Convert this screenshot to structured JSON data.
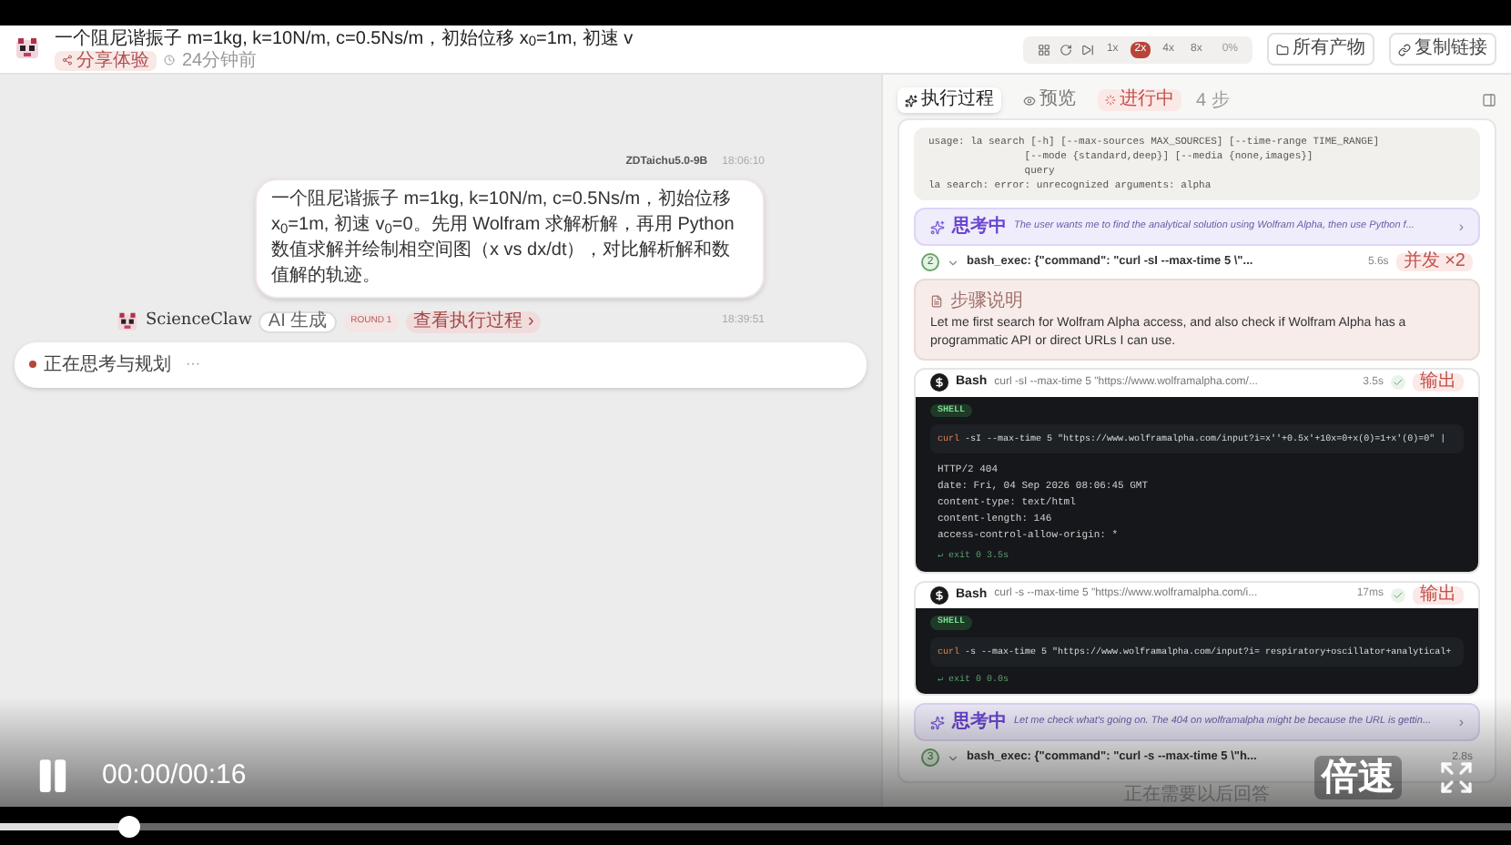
{
  "header": {
    "title": "一个阻尼谐振子 m=1kg, k=10N/m, c=0.5Ns/m，初始位移 x$_{0}$=1m, 初速 v",
    "badge": "分享体验",
    "time": "24分钟前",
    "speeds": [
      {
        "label": "1x",
        "selected": false
      },
      {
        "label": "2x",
        "selected": true
      },
      {
        "label": "4x",
        "selected": false
      },
      {
        "label": "8x",
        "selected": false
      }
    ],
    "zoom": "0%",
    "buttons": [
      {
        "kind": "folder",
        "label": "所有产物"
      },
      {
        "kind": "link",
        "label": "复制链接"
      }
    ]
  },
  "chat": {
    "user": {
      "name": "ZDTaichu5.0-9B",
      "time": "18:06:10",
      "text": "一个阻尼谐振子 m=1kg, k=10N/m, c=0.5Ns/m，初始位移 x$_{0}$=1m, 初速 v$_{0}$=0。先用 Wolfram 求解析解，再用 Python 数值求解并绘制相空间图（x vs dx/dt），对比解析解和数值解的轨迹。"
    },
    "assistant": {
      "name": "ScienceClaw",
      "tag": "AI 生成",
      "round": "ROUND 1",
      "link": "查看执行过程 ›",
      "time": "18:39:51",
      "status": "正在思考与规划",
      "dots": "···"
    }
  },
  "panel": {
    "tabs": [
      {
        "label": "执行过程",
        "selected": true
      },
      {
        "label": "预览",
        "selected": false
      }
    ],
    "state": "进行中",
    "steps": "4 步",
    "items": [
      {
        "kind": "code",
        "lines": [
          "usage: la search [-h] [--max-sources MAX_SOURCES] [--time-range TIME_RANGE]",
          "                [--mode {standard,deep}] [--media {none,images}]",
          "                query",
          "la search: error: unrecognized arguments: alpha"
        ]
      },
      {
        "kind": "thinking",
        "label": "思考中",
        "text": "The user wants me to find the analytical solution using Wolfram Alpha, then use Python f...",
        "arrow": "›"
      },
      {
        "kind": "step",
        "number": "2",
        "expanded": true,
        "text": "bash_exec: {\"command\": \"curl -sI --max-time 5 \\\"...",
        "time": "5.6s",
        "badge": "并发 ×2"
      },
      {
        "kind": "note",
        "title": "步骤说明",
        "text": "Let me first search for Wolfram Alpha access, and also check if Wolfram Alpha has a programmatic API or direct URLs I can use."
      },
      {
        "kind": "bash",
        "name": "Bash",
        "command": "curl -sI --max-time 5 \"https://www.wolframalpha.com/...",
        "time": "3.5s",
        "done": true,
        "output_label": "输出",
        "shell": "SHELL",
        "program": "curl",
        "args": "-sI --max-time 5 \"https://www.wolframalpha.com/input?i=x''+0.5x'+10x=0+x(0)=1+x'(0)=0\" |",
        "output": [
          "HTTP/2 404",
          "date: Fri, 04 Sep 2026 08:06:45 GMT",
          "content-type: text/html",
          "content-length: 146",
          "access-control-allow-origin: *"
        ],
        "exit": "↵ exit 0 3.5s"
      },
      {
        "kind": "bash",
        "name": "Bash",
        "command": "curl -s --max-time 5 \"https://www.wolframalpha.com/i...",
        "time": "17ms",
        "done": true,
        "output_label": "输出",
        "shell": "SHELL",
        "program": "curl",
        "args": "-s --max-time 5 \"https://www.wolframalpha.com/input?i= respiratory+oscillator+analytical+",
        "exit": "↵ exit 0 0.0s"
      },
      {
        "kind": "thinking",
        "label": "思考中",
        "text": "Let me check what's going on. The 404 on wolframalpha might be because the URL is gettin...",
        "arrow": "›"
      },
      {
        "kind": "step",
        "number": "3",
        "expanded": true,
        "text": "bash_exec: {\"command\": \"curl -s --max-time 5 \\\"h...",
        "time": "2.8s"
      }
    ],
    "footer": "正在需要以后回答"
  },
  "player": {
    "playing": true,
    "time": "00:00/00:16",
    "speed": "倍速",
    "level": 0.085
  }
}
